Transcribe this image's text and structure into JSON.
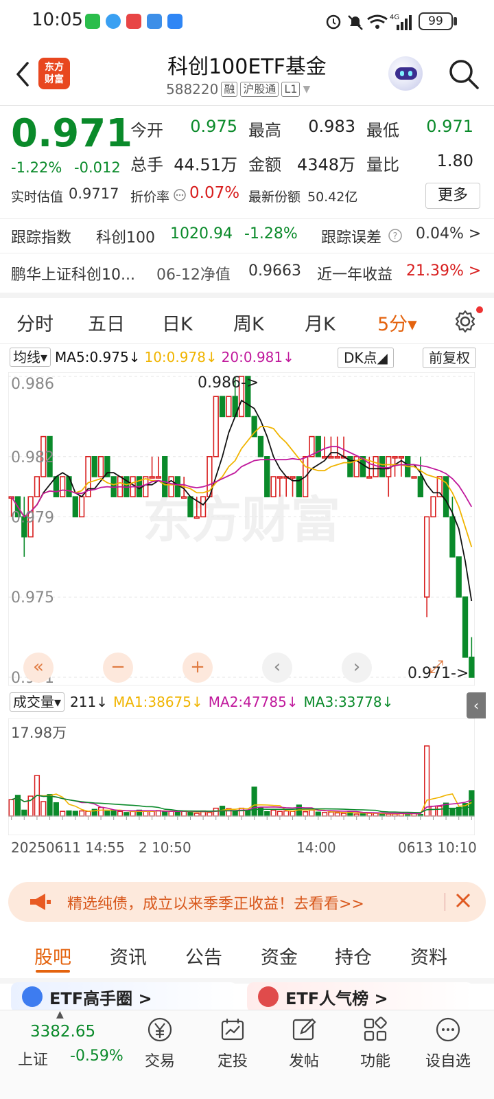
{
  "status_bar": {
    "time": "10:05",
    "battery": "99",
    "network": "4G"
  },
  "header": {
    "logo_text": "东方\n财富",
    "title": "科创100ETF基金",
    "code": "588220",
    "tags": [
      "融",
      "沪股通",
      "L1"
    ]
  },
  "quote": {
    "price": "0.971",
    "change_pct": "-1.22%",
    "change": "-0.012",
    "open_label": "今开",
    "open": "0.975",
    "high_label": "最高",
    "high": "0.983",
    "low_label": "最低",
    "low": "0.971",
    "volume_label": "总手",
    "volume": "44.51万",
    "amount_label": "金额",
    "amount": "4348万",
    "vol_ratio_label": "量比",
    "vol_ratio": "1.80",
    "iopv_label": "实时估值",
    "iopv": "0.9717",
    "discount_label": "折价率",
    "discount": "0.07%",
    "shares_label": "最新份额",
    "shares": "50.42亿",
    "more_label": "更多"
  },
  "tracking": {
    "label": "跟踪指数",
    "index_name": "科创100",
    "index_value": "1020.94",
    "index_change": "-1.28%",
    "error_label": "跟踪误差",
    "error_value": "0.04% >"
  },
  "fund": {
    "name": "鹏华上证科创10...",
    "nav_label": "06-12净值",
    "nav": "0.9663",
    "return_label": "近一年收益",
    "return_value": "21.39% >"
  },
  "chart_tabs": {
    "items": [
      "分时",
      "五日",
      "日K",
      "周K",
      "月K"
    ],
    "active": "5分▾"
  },
  "ma_bar": {
    "dropdown": "均线▾",
    "ma5": "MA5:0.975↓",
    "ma10": "10:0.978↓",
    "ma20": "20:0.981↓",
    "dk_label": "DK点◢",
    "adjust_label": "前复权"
  },
  "chart_labels": {
    "y_ticks": [
      "0.986",
      "0.982",
      "0.979",
      "0.975",
      "0.971"
    ],
    "high_mark": "0.986->",
    "low_mark": "0.971->",
    "watermark": "东方财富"
  },
  "controls": [
    "«",
    "−",
    "+",
    "‹",
    "›",
    "⤢"
  ],
  "volume_bar": {
    "dropdown": "成交量▾",
    "value": "211↓",
    "ma1": "MA1:38675↓",
    "ma2": "MA2:47785↓",
    "ma3": "MA3:33778↓",
    "y_max": "17.98万"
  },
  "x_axis": {
    "left": "20250611 14:55",
    "mid1": "2 10:50",
    "mid2": "14:00",
    "right": "0613 10:10"
  },
  "banner": {
    "text": "精选纯债，成立以来季季正收益！去看看>>"
  },
  "bottom_tabs": {
    "items": [
      "股吧",
      "资讯",
      "公告",
      "资金",
      "持仓",
      "资料"
    ],
    "active_index": 0
  },
  "cards": [
    "ETF高手圈 >",
    "ETF人气榜 >"
  ],
  "nav": {
    "index_value": "3382.65",
    "index_name": "上证",
    "index_change": "-0.59%",
    "items": [
      "交易",
      "定投",
      "发帖",
      "功能",
      "设自选"
    ]
  },
  "colors": {
    "up": "#d81e1e",
    "down": "#0a8a2a",
    "accent": "#e4630e",
    "ma5": "#111111",
    "ma10": "#f0b400",
    "ma20": "#c0189c"
  },
  "chart_data": {
    "type": "candlestick",
    "y_range": [
      0.971,
      0.986
    ],
    "candles_ohl_c": [
      [
        0.98,
        0.98,
        0.979,
        0.98
      ],
      [
        0.98,
        0.98,
        0.979,
        0.979
      ],
      [
        0.979,
        0.98,
        0.977,
        0.978
      ],
      [
        0.978,
        0.98,
        0.978,
        0.98
      ],
      [
        0.98,
        0.981,
        0.98,
        0.981
      ],
      [
        0.981,
        0.983,
        0.981,
        0.983
      ],
      [
        0.983,
        0.983,
        0.981,
        0.981
      ],
      [
        0.981,
        0.981,
        0.98,
        0.98
      ],
      [
        0.98,
        0.981,
        0.98,
        0.981
      ],
      [
        0.981,
        0.981,
        0.98,
        0.98
      ],
      [
        0.98,
        0.98,
        0.979,
        0.979
      ],
      [
        0.979,
        0.98,
        0.979,
        0.98
      ],
      [
        0.98,
        0.982,
        0.98,
        0.982
      ],
      [
        0.982,
        0.982,
        0.981,
        0.981
      ],
      [
        0.981,
        0.982,
        0.981,
        0.982
      ],
      [
        0.982,
        0.982,
        0.981,
        0.981
      ],
      [
        0.981,
        0.981,
        0.98,
        0.98
      ],
      [
        0.98,
        0.981,
        0.98,
        0.981
      ],
      [
        0.981,
        0.981,
        0.98,
        0.98
      ],
      [
        0.98,
        0.981,
        0.98,
        0.981
      ],
      [
        0.981,
        0.981,
        0.98,
        0.98
      ],
      [
        0.98,
        0.981,
        0.98,
        0.981
      ],
      [
        0.981,
        0.982,
        0.981,
        0.981
      ],
      [
        0.981,
        0.982,
        0.981,
        0.981
      ],
      [
        0.982,
        0.982,
        0.98,
        0.98
      ],
      [
        0.98,
        0.981,
        0.98,
        0.981
      ],
      [
        0.981,
        0.981,
        0.98,
        0.98
      ],
      [
        0.98,
        0.981,
        0.98,
        0.98
      ],
      [
        0.98,
        0.98,
        0.979,
        0.979
      ],
      [
        0.979,
        0.98,
        0.979,
        0.979
      ],
      [
        0.979,
        0.98,
        0.979,
        0.98
      ],
      [
        0.98,
        0.982,
        0.98,
        0.982
      ],
      [
        0.982,
        0.985,
        0.982,
        0.985
      ],
      [
        0.985,
        0.985,
        0.984,
        0.984
      ],
      [
        0.984,
        0.985,
        0.984,
        0.985
      ],
      [
        0.985,
        0.986,
        0.984,
        0.984
      ],
      [
        0.984,
        0.986,
        0.984,
        0.986
      ],
      [
        0.986,
        0.986,
        0.984,
        0.984
      ],
      [
        0.984,
        0.984,
        0.983,
        0.983
      ],
      [
        0.983,
        0.983,
        0.982,
        0.982
      ],
      [
        0.982,
        0.982,
        0.98,
        0.98
      ],
      [
        0.98,
        0.981,
        0.98,
        0.981
      ],
      [
        0.981,
        0.981,
        0.98,
        0.981
      ],
      [
        0.981,
        0.981,
        0.98,
        0.981
      ],
      [
        0.981,
        0.981,
        0.98,
        0.981
      ],
      [
        0.981,
        0.981,
        0.98,
        0.98
      ],
      [
        0.98,
        0.982,
        0.98,
        0.982
      ],
      [
        0.982,
        0.983,
        0.982,
        0.983
      ],
      [
        0.983,
        0.983,
        0.982,
        0.982
      ],
      [
        0.982,
        0.983,
        0.982,
        0.982
      ],
      [
        0.982,
        0.983,
        0.982,
        0.982
      ],
      [
        0.982,
        0.983,
        0.982,
        0.982
      ],
      [
        0.982,
        0.983,
        0.982,
        0.982
      ],
      [
        0.982,
        0.982,
        0.981,
        0.981
      ],
      [
        0.981,
        0.982,
        0.981,
        0.982
      ],
      [
        0.982,
        0.982,
        0.981,
        0.981
      ],
      [
        0.981,
        0.982,
        0.981,
        0.981
      ],
      [
        0.981,
        0.982,
        0.981,
        0.982
      ],
      [
        0.982,
        0.982,
        0.981,
        0.981
      ],
      [
        0.981,
        0.982,
        0.98,
        0.982
      ],
      [
        0.982,
        0.982,
        0.981,
        0.982
      ],
      [
        0.982,
        0.982,
        0.981,
        0.982
      ],
      [
        0.982,
        0.982,
        0.981,
        0.981
      ],
      [
        0.981,
        0.981,
        0.981,
        0.981
      ],
      [
        0.981,
        0.982,
        0.98,
        0.98
      ],
      [
        0.975,
        0.979,
        0.974,
        0.979
      ],
      [
        0.979,
        0.98,
        0.979,
        0.98
      ],
      [
        0.98,
        0.981,
        0.98,
        0.981
      ],
      [
        0.981,
        0.981,
        0.979,
        0.979
      ],
      [
        0.979,
        0.98,
        0.977,
        0.977
      ],
      [
        0.977,
        0.977,
        0.975,
        0.975
      ],
      [
        0.975,
        0.975,
        0.972,
        0.972
      ],
      [
        0.972,
        0.973,
        0.971,
        0.971
      ]
    ],
    "ma_series": [
      {
        "name": "MA5",
        "color": "#111111"
      },
      {
        "name": "MA10",
        "color": "#f0b400"
      },
      {
        "name": "MA20",
        "color": "#c0189c"
      }
    ],
    "volume": [
      4.2,
      5.3,
      1.5,
      5.1,
      10.4,
      3.7,
      5.5,
      3.4,
      1.2,
      1.3,
      1.2,
      1.3,
      1.2,
      1.7,
      2.2,
      1.2,
      1.3,
      1.2,
      0.9,
      1.2,
      1.5,
      1.2,
      1.2,
      1.4,
      1.2,
      1.2,
      1.0,
      1.3,
      1.2,
      0.7,
      1.3,
      0.9,
      2.0,
      2.5,
      1.9,
      1.3,
      2.0,
      1.5,
      7.4,
      2.1,
      1.1,
      1.5,
      1.2,
      1.3,
      1.2,
      2.8,
      1.1,
      1.5,
      1.0,
      0.9,
      1.0,
      0.8,
      0.7,
      1.1,
      0.5,
      0.8,
      0.7,
      0.7,
      0.5,
      0.5,
      0.5,
      0.7,
      0.6,
      0.6,
      0.4,
      17.98,
      2.5,
      2.5,
      3.3,
      2.0,
      2.2,
      3.2,
      6.5
    ],
    "volume_max_label": "17.98万"
  }
}
